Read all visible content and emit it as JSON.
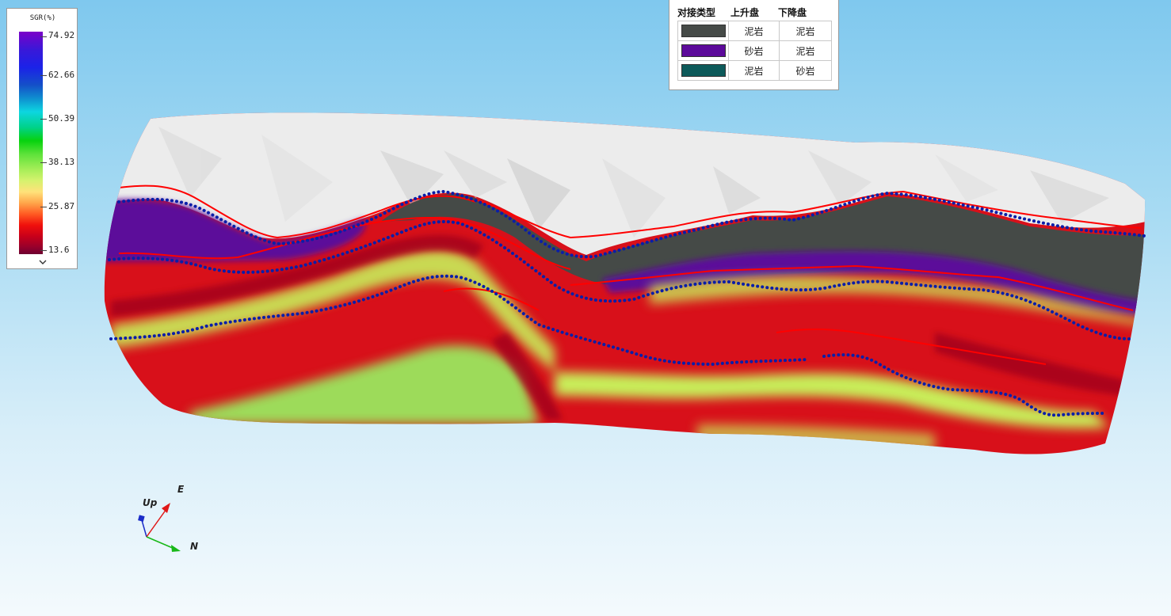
{
  "colorbar": {
    "title": "SGR(%)",
    "ticks": [
      "74.92",
      "62.66",
      "50.39",
      "38.13",
      "25.87",
      "13.6"
    ],
    "expand_icon": "chevron-down-icon"
  },
  "fault_legend": {
    "headers": [
      "对接类型",
      "上升盘",
      "下降盘"
    ],
    "rows": [
      {
        "color": "#454a47",
        "up": "泥岩",
        "down": "泥岩"
      },
      {
        "color": "#5c0a9a",
        "up": "砂岩",
        "down": "泥岩"
      },
      {
        "color": "#0d5a5a",
        "up": "泥岩",
        "down": "砂岩"
      }
    ]
  },
  "axes": {
    "up": "Up",
    "east": "E",
    "north": "N"
  },
  "colors": {
    "sky_top": "#7fc8ee",
    "sky_bottom": "#f4fafd",
    "fault_surface": "#ececec",
    "horizon_dots": "#0a1ea8",
    "fault_lines": "#ff0000"
  }
}
